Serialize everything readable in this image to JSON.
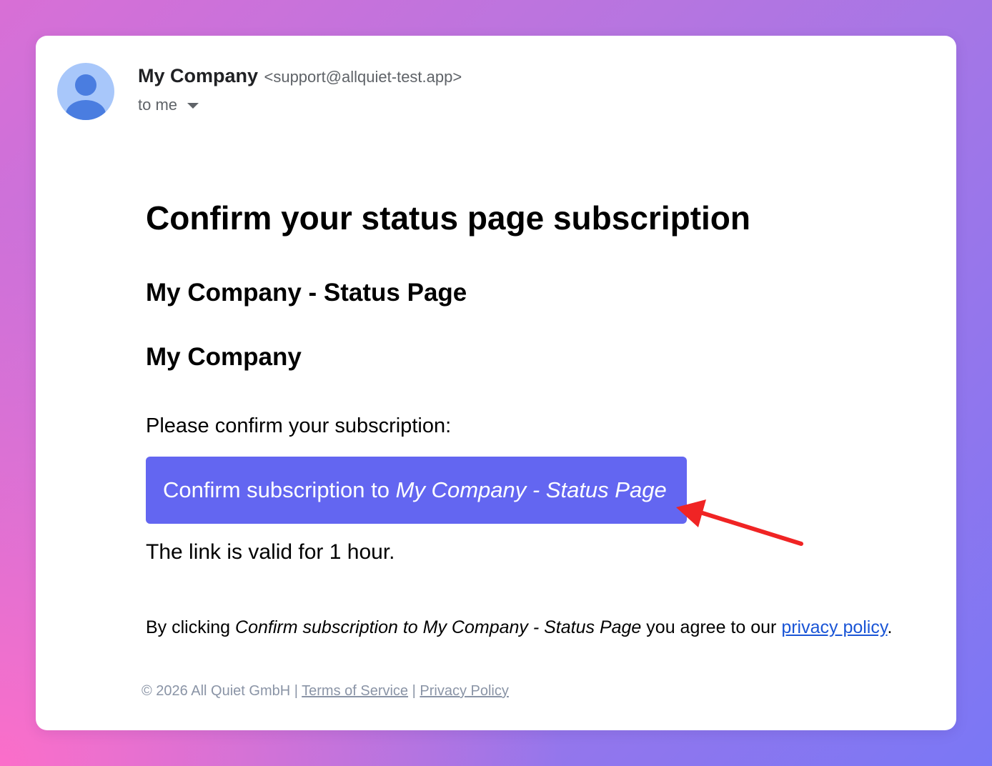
{
  "sender": {
    "name": "My Company",
    "email": "<support@allquiet-test.app>",
    "recipient_label": "to me"
  },
  "email": {
    "title": "Confirm your status page subscription",
    "status_page_name": "My Company - Status Page",
    "company_name": "My Company",
    "prompt": "Please confirm your subscription:",
    "button": {
      "prefix": "Confirm subscription to ",
      "target": "My Company - Status Page"
    },
    "validity": "The link is valid for 1 hour.",
    "agreement": {
      "prefix": "By clicking ",
      "action_text": "Confirm subscription to My Company - Status Page",
      "middle": " you agree to our ",
      "link": "privacy policy",
      "suffix": "."
    }
  },
  "footer": {
    "copyright": "© 2026 All Quiet GmbH",
    "separator": " | ",
    "terms_link": "Terms of Service",
    "privacy_link": "Privacy Policy"
  },
  "colors": {
    "button_bg": "#6366f1",
    "link": "#1a55d6",
    "footer_text": "#8a94a6",
    "arrow": "#f02424",
    "avatar_bg": "#a8c7fa",
    "avatar_fg": "#4a7de0"
  },
  "icons": {
    "avatar": "default-person-avatar-icon",
    "recipient_caret": "caret-down-icon",
    "annotation": "red-arrow-annotation-icon"
  }
}
